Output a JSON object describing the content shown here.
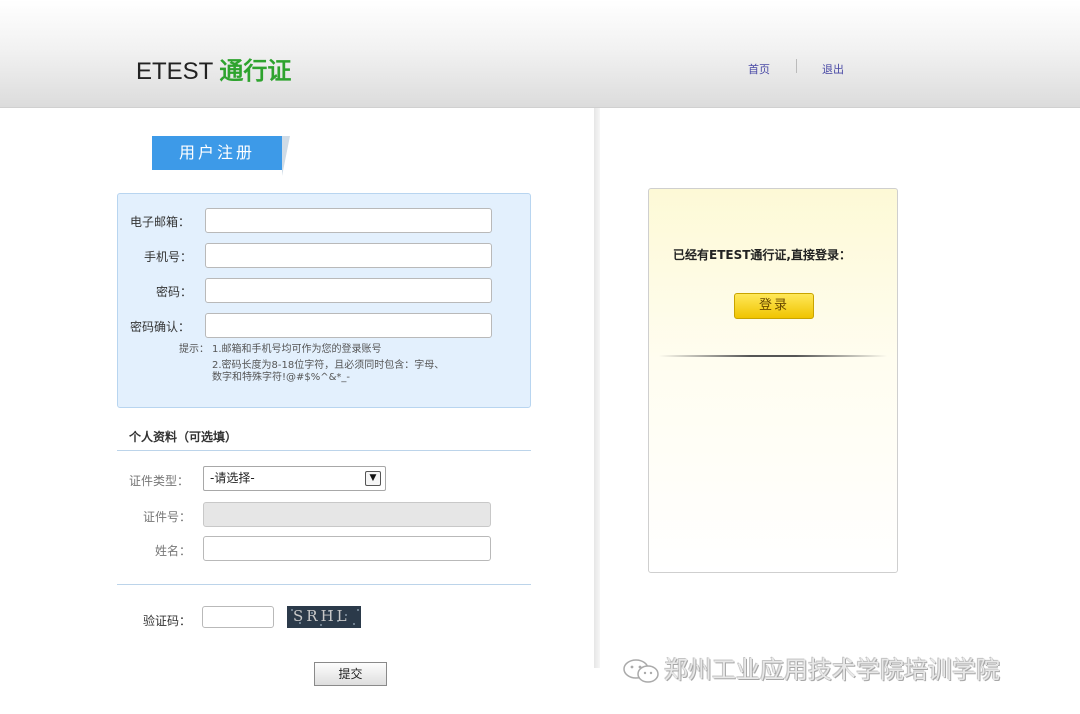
{
  "header": {
    "brand_prefix": "ETEST",
    "brand_accent": "通行证",
    "nav_home": "首页",
    "nav_logout": "退出"
  },
  "register": {
    "tab_label": "用户注册",
    "email_label": "电子邮箱：",
    "email_value": "",
    "phone_label": "手机号：",
    "phone_value": "",
    "password_label": "密码：",
    "password_value": "",
    "confirm_label": "密码确认：",
    "confirm_value": "",
    "hint_prefix": "提示：",
    "hint_line1": "1.邮箱和手机号均可作为您的登录账号",
    "hint_line2": "2.密码长度为8-18位字符，且必须同时包含：字母、",
    "hint_line3": "数字和特殊字符!@#$%^&*_-"
  },
  "profile": {
    "section_title": "个人资料（可选填）",
    "id_type_label": "证件类型：",
    "id_type_selected": "-请选择-",
    "id_number_label": "证件号：",
    "name_label": "姓名：",
    "captcha_label": "验证码：",
    "captcha_text": "SRHL",
    "submit_label": "提交"
  },
  "login": {
    "prompt": "已经有ETEST通行证,直接登录：",
    "button_label": "登录"
  },
  "watermark": {
    "text": "郑州工业应用技术学院培训学院"
  },
  "colors": {
    "brand_green": "#2ea32e",
    "tab_blue": "#3d9ae8",
    "login_yellow": "#f0c400"
  }
}
